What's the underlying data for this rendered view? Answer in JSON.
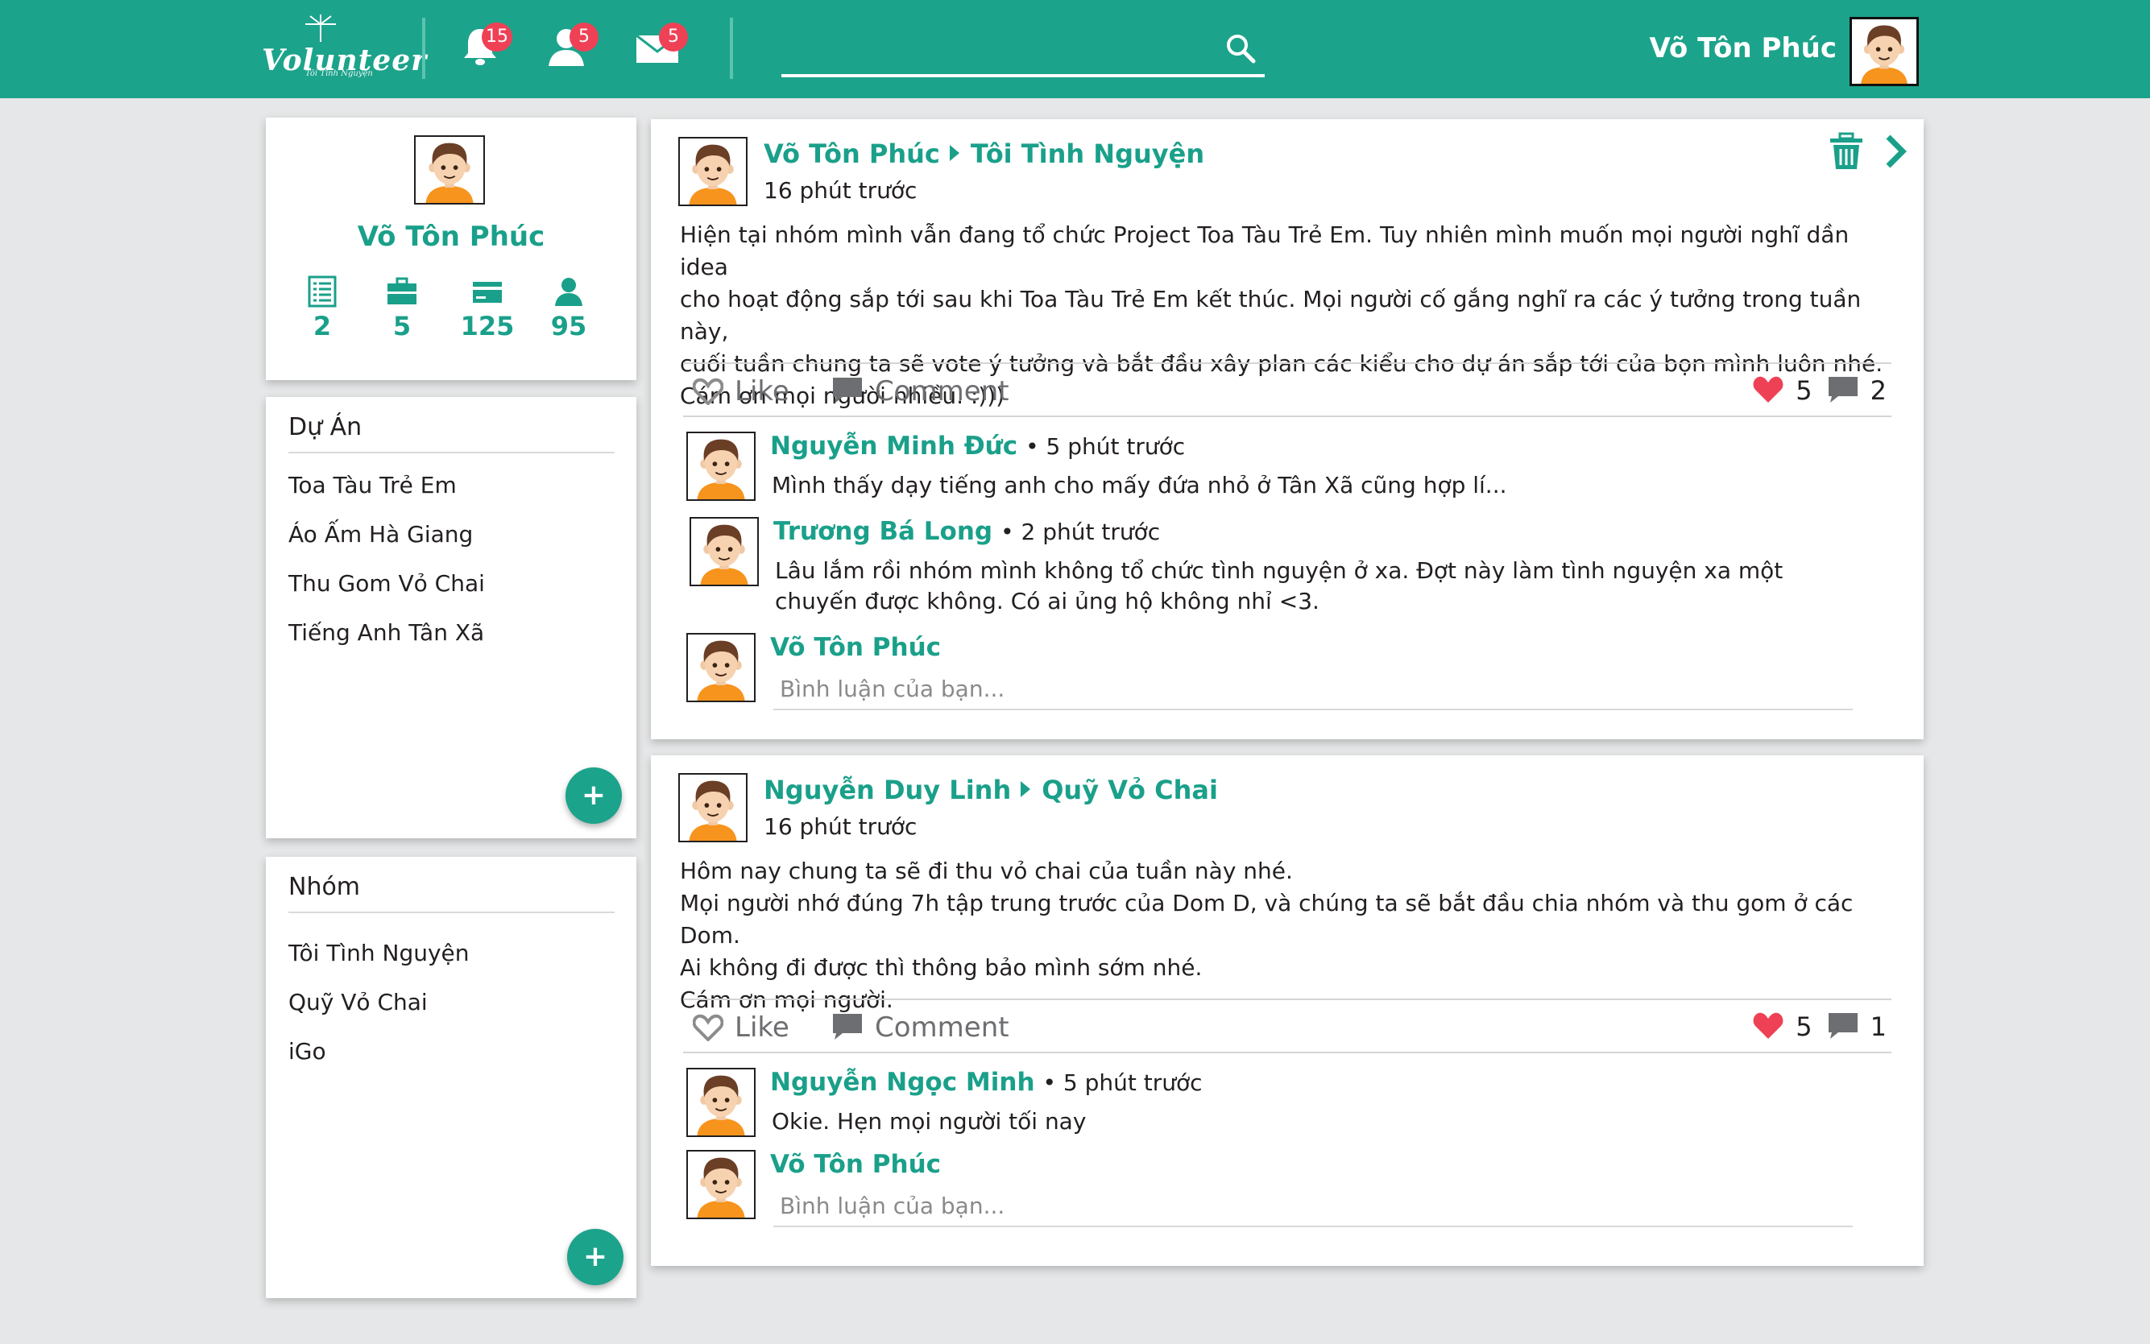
{
  "topbar": {
    "logo_word": "Volunteer",
    "logo_sub": "Tôi Tình Nguyện",
    "notifications_count": "15",
    "friends_count": "5",
    "messages_count": "5",
    "search_placeholder": "",
    "username": "Võ Tôn Phúc"
  },
  "profile": {
    "name": "Võ Tôn Phúc",
    "stats": [
      "2",
      "5",
      "125",
      "95"
    ]
  },
  "projects": {
    "title": "Dự Án",
    "items": [
      "Toa Tàu Trẻ Em",
      "Áo Ấm Hà Giang",
      "Thu Gom Vỏ Chai",
      "Tiếng Anh Tân Xã"
    ],
    "add_label": "+"
  },
  "groups": {
    "title": "Nhóm",
    "items": [
      "Tôi Tình Nguyện",
      "Quỹ Vỏ Chai",
      "iGo"
    ],
    "add_label": "+"
  },
  "posts": [
    {
      "author": "Võ Tôn Phúc",
      "target": "Tôi Tình Nguyện",
      "time": "16 phút trước",
      "lines": [
        "Hiện tại nhóm mình vẫn đang tổ chức Project Toa Tàu Trẻ Em. Tuy nhiên mình muốn mọi người nghĩ dần idea",
        "cho hoạt động sắp tới sau khi Toa Tàu Trẻ Em kết thúc. Mọi người cố gắng nghĩ ra các ý tưởng trong tuần này,",
        "cuối tuần chung ta sẽ vote ý tưởng và bắt đầu xây plan các kiểu cho dự án sắp tới của bọn mình luôn nhé.",
        "Cám ơn mọi người nhiều. :)))"
      ],
      "like_label": "Like",
      "comment_label": "Comment",
      "likes": "5",
      "comments": "2",
      "comment_list": [
        {
          "name": "Nguyễn Minh Đức",
          "time": "• 5 phút trước",
          "text": "Mình thấy dạy tiếng anh cho mấy đứa nhỏ ở Tân Xã cũng hợp lí..."
        },
        {
          "name": "Trương Bá Long",
          "time": "• 2 phút trước",
          "text": "Lâu lắm rồi nhóm mình không tổ chức tình nguyện ở xa. Đợt này làm tình nguyện xa một chuyến được không. Có ai ủng hộ không nhỉ <3."
        }
      ],
      "reply": {
        "name": "Võ Tôn Phúc",
        "placeholder": "Bình luận của bạn..."
      }
    },
    {
      "author": "Nguyễn Duy Linh",
      "target": "Quỹ Vỏ Chai",
      "time": "16 phút trước",
      "lines": [
        "Hôm nay chung ta sẽ đi thu vỏ chai của tuần này nhé.",
        "Mọi người nhớ đúng 7h tập trung trước của Dom D, và chúng ta sẽ bắt đầu chia nhóm và thu gom ở các Dom.",
        "Ai không đi được thì thông bảo mình sớm nhé.",
        "Cám ơn mọi người."
      ],
      "like_label": "Like",
      "comment_label": "Comment",
      "likes": "5",
      "comments": "1",
      "comment_list": [
        {
          "name": "Nguyễn Ngọc Minh",
          "time": "• 5 phút trước",
          "text": "Okie. Hẹn mọi người tối nay"
        }
      ],
      "reply": {
        "name": "Võ Tôn Phúc",
        "placeholder": "Bình luận của bạn..."
      }
    }
  ],
  "colors": {
    "accent": "#1ca38b",
    "badge": "#ef4156",
    "heart": "#ef4156"
  }
}
